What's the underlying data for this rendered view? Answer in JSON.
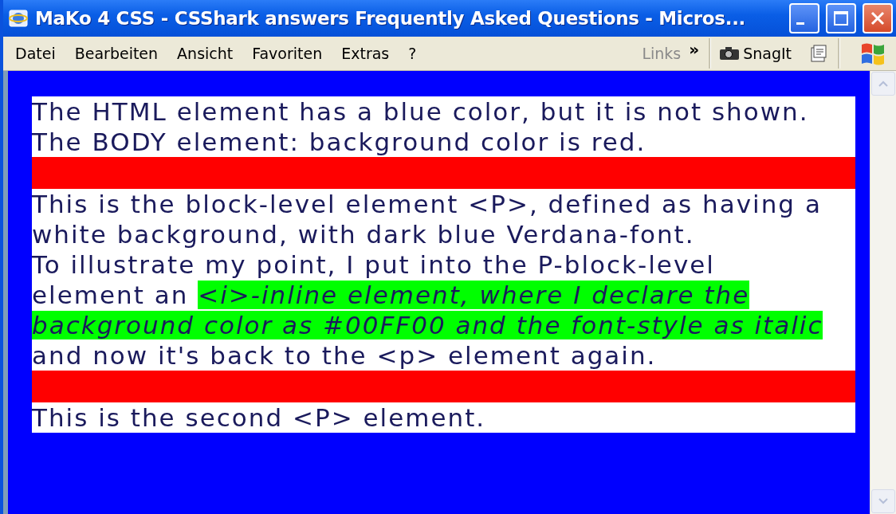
{
  "window": {
    "title": "MaKo 4 CSS - CSShark answers Frequently Asked Questions - Micros..."
  },
  "menu": [
    {
      "label": "Datei"
    },
    {
      "label": "Bearbeiten"
    },
    {
      "label": "Ansicht"
    },
    {
      "label": "Favoriten"
    },
    {
      "label": "Extras"
    },
    {
      "label": "?"
    }
  ],
  "links": {
    "label": "Links",
    "chevron": "»"
  },
  "toolbar": {
    "snagit": "SnagIt"
  },
  "page": [
    {
      "kind": "paragraph",
      "lines": [
        "The HTML element has a blue color, but it is not shown.",
        "The BODY element: background color is red."
      ]
    },
    {
      "kind": "bar"
    },
    {
      "kind": "paragraph",
      "lines": [
        "This is the block-level element <P>, defined as having a",
        "white background, with dark blue Verdana-font.",
        "To illustrate my point, I put into the P-block-level",
        "element an *<i>-inline element, where I declare the*",
        "*background color as #00FF00 and the font-style as italic*",
        "and now it's back to the <p> element again."
      ]
    },
    {
      "kind": "bar"
    },
    {
      "kind": "paragraph",
      "lines": [
        "This is the second <P> element."
      ]
    }
  ]
}
